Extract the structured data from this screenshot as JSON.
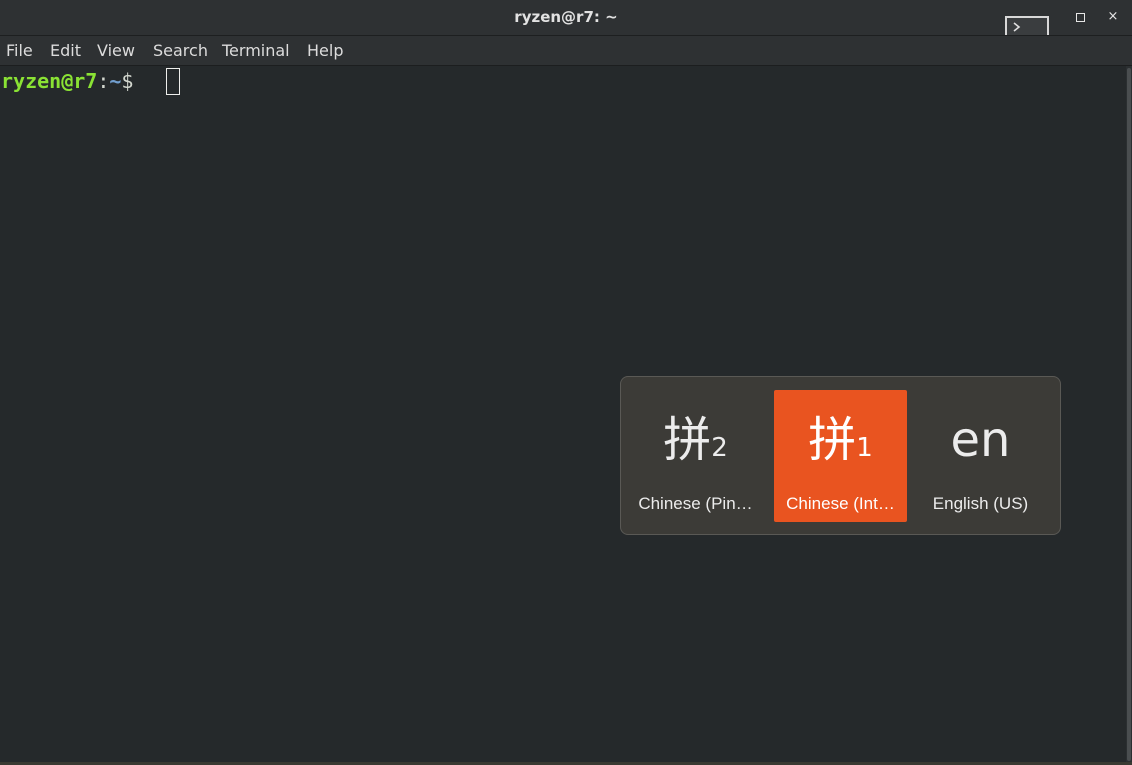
{
  "window": {
    "title": "ryzen@r7: ~"
  },
  "menubar": {
    "items": [
      {
        "label": "File"
      },
      {
        "label": "Edit"
      },
      {
        "label": "View"
      },
      {
        "label": "Search"
      },
      {
        "label": "Terminal"
      },
      {
        "label": "Help"
      }
    ]
  },
  "terminal": {
    "prompt_user_host": "ryzen@r7",
    "prompt_colon": ":",
    "prompt_path": "~",
    "prompt_symbol": "$"
  },
  "input_source_switcher": {
    "accent_color": "#e95420",
    "sources": [
      {
        "glyph": "拼",
        "sub": "2",
        "label": "Chinese (Pin…",
        "selected": false
      },
      {
        "glyph": "拼",
        "sub": "1",
        "label": "Chinese (Int…",
        "selected": true
      },
      {
        "glyph": "en",
        "sub": "",
        "label": "English (US)",
        "selected": false
      }
    ]
  },
  "icons": {
    "terminal_thumb": "terminal-icon",
    "maximize": "maximize-icon",
    "close": "close-icon",
    "close_glyph": "×"
  }
}
